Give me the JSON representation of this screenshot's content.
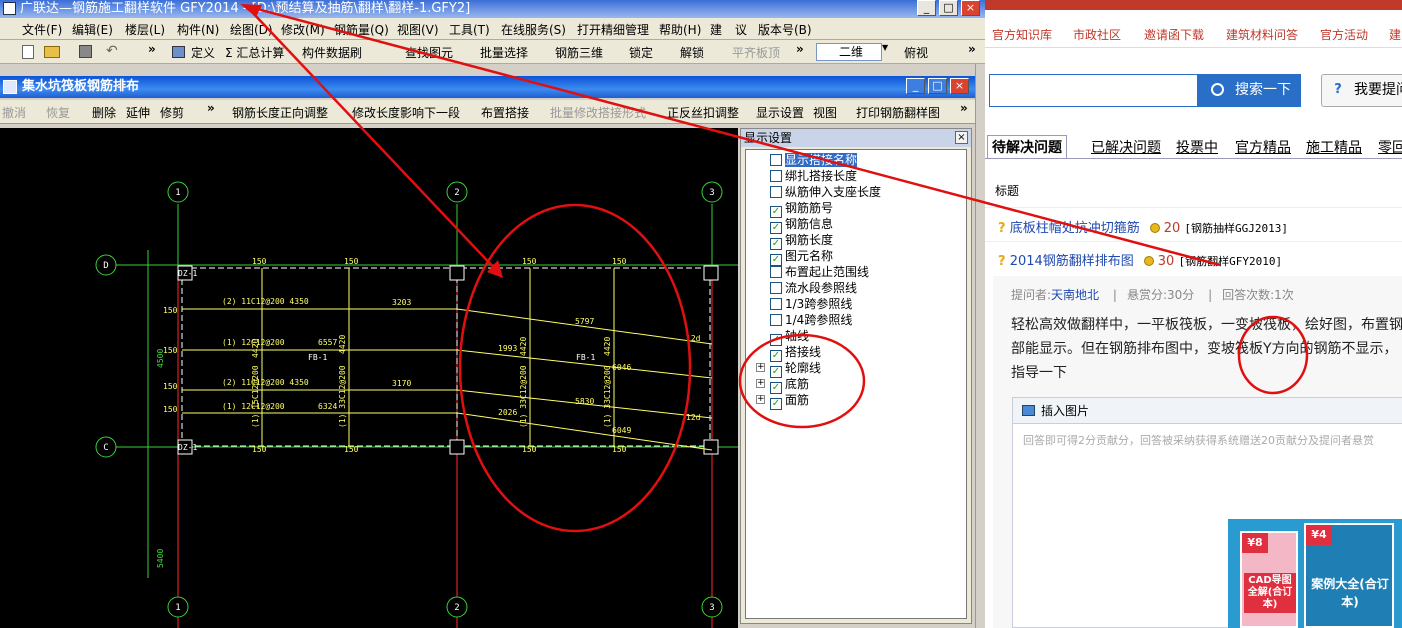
{
  "app": {
    "title": "广联达—钢筋施工翻样软件 GFY2014 - [D:\\预结算及抽筋\\翻样\\翻样-1.GFY2]",
    "window_controls": [
      "_",
      "□",
      "×"
    ]
  },
  "menubar": [
    "文件(F)",
    "编辑(E)",
    "楼层(L)",
    "构件(N)",
    "绘图(D)",
    "修改(M)",
    "钢筋量(Q)",
    "视图(V)",
    "工具(T)",
    "在线服务(S)",
    "打开精细管理",
    "帮助(H)",
    "建",
    "议",
    "版本号(B)"
  ],
  "toolbar1": {
    "items": [
      "定义",
      "Σ 汇总计算",
      "构件数据刷",
      "查找图元",
      "批量选择",
      "钢筋三维",
      "锁定",
      "解锁",
      "平齐板顶"
    ],
    "view_mode": "二维",
    "view_dir": "俯视",
    "more": "»"
  },
  "child_window": {
    "title": "集水坑筏板钢筋排布",
    "controls": [
      "_",
      "□",
      "×"
    ],
    "toolbar": [
      "撤消",
      "恢复",
      "删除",
      "延伸",
      "修剪",
      "»",
      "钢筋长度正向调整",
      "修改长度影响下一段",
      "布置搭接",
      "批量修改搭接形式",
      "正反丝扣调整",
      "显示设置",
      "视图",
      "打印钢筋翻样图",
      "»"
    ]
  },
  "display_panel": {
    "title": "显示设置",
    "items": [
      {
        "label": "显示搭接名称",
        "checked": false
      },
      {
        "label": "绑扎搭接长度",
        "checked": false
      },
      {
        "label": "纵筋伸入支座长度",
        "checked": false
      },
      {
        "label": "钢筋筋号",
        "checked": true
      },
      {
        "label": "钢筋信息",
        "checked": true
      },
      {
        "label": "钢筋长度",
        "checked": true
      },
      {
        "label": "图元名称",
        "checked": true
      },
      {
        "label": "布置起止范围线",
        "checked": false
      },
      {
        "label": "流水段参照线",
        "checked": false
      },
      {
        "label": "1/3跨参照线",
        "checked": false
      },
      {
        "label": "1/4跨参照线",
        "checked": false
      },
      {
        "label": "轴线",
        "checked": true
      },
      {
        "label": "搭接线",
        "checked": true
      },
      {
        "label": "轮廓线",
        "checked": true,
        "expandable": true
      },
      {
        "label": "底筋",
        "checked": true,
        "expandable": true
      },
      {
        "label": "面筋",
        "checked": true,
        "expandable": true
      }
    ]
  },
  "cad": {
    "axes_top": [
      "1",
      "2",
      "3"
    ],
    "axes_left": [
      "D",
      "C"
    ],
    "dims_left": [
      "4500",
      "5400"
    ],
    "labels": {
      "fb1": "FB-1",
      "dz": "DZ-1",
      "r1": "(2) 11C12@200 4350",
      "r2": "(1) 12C12@200",
      "r3": "(2) 11C12@200 4350",
      "r4": "(1) 12C12@200",
      "n6557": "6557",
      "n6324": "6324",
      "n3203": "3203",
      "n3170": "3170",
      "n150": "150",
      "n5797": "5797",
      "n1993": "1993",
      "n6046": "6046",
      "n5830": "5830",
      "n2026": "2026",
      "n6049": "6049",
      "n4420": "4420",
      "n12d": "12d",
      "v1": "(1) 15C12@200",
      "v2": "(1) 33C12@200",
      "v3": "(1) 33C12@200"
    }
  },
  "web": {
    "top_links": [
      "官方知识库",
      "市政社区",
      "邀请函下载",
      "建筑材料问答",
      "官方活动",
      "建"
    ],
    "search_button": "搜索一下",
    "ask_button": "我要提问",
    "tabs": [
      "待解决问题",
      "已解决问题",
      "投票中",
      "官方精品",
      "施工精品",
      "零回"
    ],
    "column_header": "标题",
    "questions": [
      {
        "title": "底板柱帽处抗冲切箍筋",
        "points": "20",
        "tag": "[钢筋抽样GGJ2013]"
      },
      {
        "title": "2014钢筋翻样排布图",
        "points": "30",
        "tag": "[钢筋翻样GFY2010]"
      }
    ],
    "meta": {
      "asker_label": "提问者:",
      "asker": "天南地北",
      "reward": "悬赏分:30分",
      "answers": "回答次数:1次",
      "sep": "|"
    },
    "body_lines": [
      "轻松高效做翻样中，一平板筏板，一变坡筏板，绘好图，布置钢",
      "部能显示。但在钢筋排布图中，变坡筏板Y方向的钢筋不显示，",
      "指导一下"
    ],
    "insert_image": "插入图片",
    "answer_placeholder": "回答即可得2分贡献分，回答被采纳获得系统赠送20贡献分及提问者悬赏",
    "ads": [
      {
        "badge": "¥8",
        "text": "CAD导图全解(合订本)"
      },
      {
        "badge": "¥4",
        "text": "案例大全(合订本)"
      }
    ]
  },
  "colors": {
    "annotation_red": "#e01010",
    "cad_yellow": "#ffff66",
    "cad_green": "#44dd44",
    "link_blue": "#1f48b0",
    "brand_red": "#c0392b",
    "search_blue": "#2a6fc7"
  }
}
